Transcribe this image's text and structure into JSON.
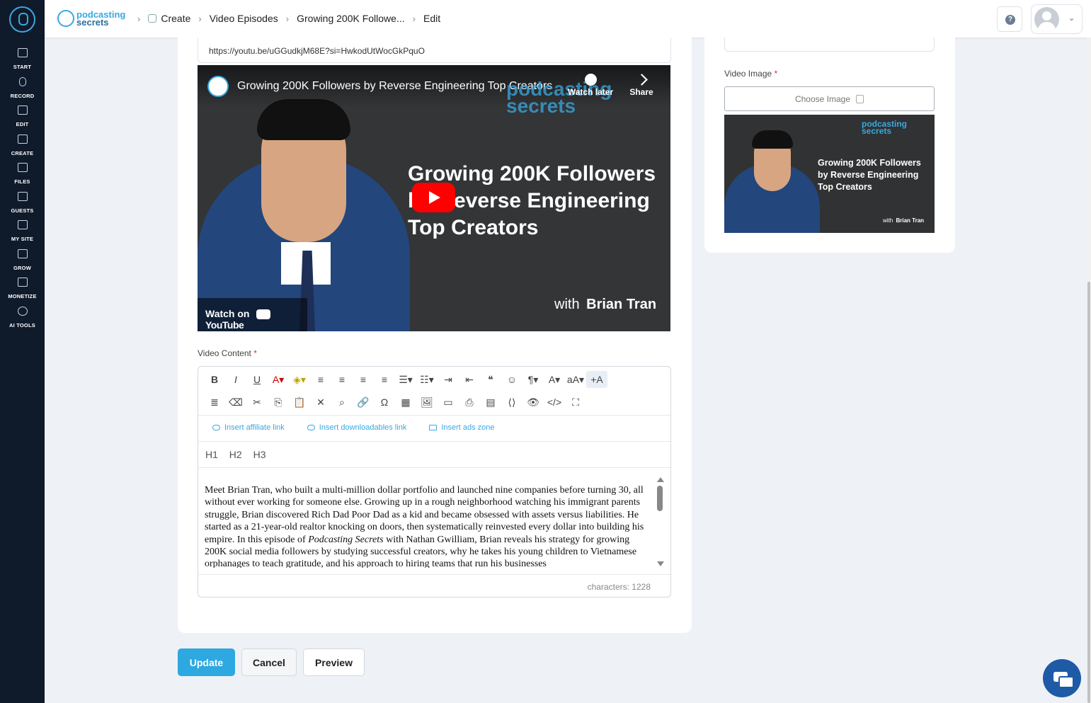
{
  "sidebar": {
    "items": [
      {
        "label": "START",
        "icon": "store-icon"
      },
      {
        "label": "RECORD",
        "icon": "microphone-icon"
      },
      {
        "label": "EDIT",
        "icon": "edit-icon"
      },
      {
        "label": "CREATE",
        "icon": "create-icon"
      },
      {
        "label": "FILES",
        "icon": "folder-icon"
      },
      {
        "label": "GUESTS",
        "icon": "guests-icon"
      },
      {
        "label": "MY SITE",
        "icon": "site-icon"
      },
      {
        "label": "GROW",
        "icon": "chart-icon"
      },
      {
        "label": "MONETIZE",
        "icon": "money-icon"
      },
      {
        "label": "AI TOOLS",
        "icon": "ai-icon"
      }
    ]
  },
  "header": {
    "brand_line1": "podcasting",
    "brand_line2": "secrets",
    "breadcrumbs": [
      "Create",
      "Video Episodes",
      "Growing 200K Followe...",
      "Edit"
    ],
    "help_label": "?"
  },
  "form": {
    "video_url": "https://youtu.be/uGGudkjM68E?si=HwkodUtWocGkPquO",
    "video_content_label": "Video Content",
    "video_image_label": "Video Image",
    "required_mark": "*",
    "choose_image_label": "Choose Image"
  },
  "video": {
    "title": "Growing 200K Followers by Reverse Engineering Top Creators",
    "watermark_line1": "podcasting",
    "watermark_line2": "secrets",
    "watch_later": "Watch later",
    "share": "Share",
    "headline": "Growing 200K Followers by Reverse Engineering Top Creators",
    "with_prefix": "with",
    "host": "Brian Tran",
    "watch_on": "Watch on",
    "youtube": "YouTube"
  },
  "thumbnail": {
    "logo_line1": "podcasting",
    "logo_line2": "secrets",
    "title": "Growing 200K Followers by Reverse Engineering Top Creators",
    "with_prefix": "with",
    "host": "Brian Tran"
  },
  "editor": {
    "toolbar_row1": [
      "B",
      "I",
      "U",
      "A▾",
      "◈▾",
      "≡",
      "≡",
      "≡",
      "≡",
      "☰▾",
      "☷▾",
      "⇥",
      "⇤",
      "❝",
      "☺",
      "¶▾",
      "A▾",
      "aA▾",
      "+A"
    ],
    "toolbar_row2": [
      "≣",
      "⌫",
      "✂",
      "⎘",
      "📋",
      "✕",
      "⌕",
      "🔗",
      "Ω",
      "▦",
      "🖼",
      "▭",
      "⎙",
      "▤",
      "⟨⟩",
      "👁",
      "</>",
      "⛶"
    ],
    "insert_affiliate": "Insert affiliate link",
    "insert_downloadables": "Insert downloadables link",
    "insert_ads": "Insert ads zone",
    "headings": [
      "H1",
      "H2",
      "H3"
    ],
    "content_part1": "Meet Brian Tran, who built a multi-million dollar portfolio and launched nine companies before turning 30, all without ever working for someone else. Growing up in a rough neighborhood watching his immigrant parents struggle, Brian discovered Rich Dad Poor Dad as a kid and became obsessed with assets versus liabilities. He started as a 21-year-old realtor knocking on doors, then systematically reinvested every dollar into building his empire. In this episode of ",
    "content_italic": "Podcasting Secrets",
    "content_part2": " with Nathan Gwilliam, Brian reveals his strategy for growing 200K social media followers by studying successful creators, why he takes his young children to Vietnamese orphanages to teach gratitude, and his approach to hiring teams that run his businesses",
    "characters": "characters: 1228"
  },
  "actions": {
    "update": "Update",
    "cancel": "Cancel",
    "preview": "Preview"
  },
  "colors": {
    "accent": "#2ea8e0",
    "sidebar": "#0f1a2b",
    "required": "#e03131",
    "chat": "#1f5aa6"
  }
}
